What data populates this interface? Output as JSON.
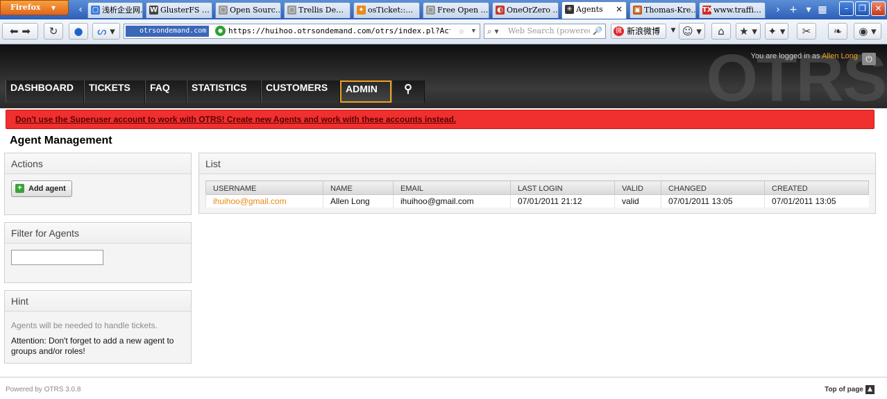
{
  "browser": {
    "menu_label": "Firefox",
    "tabs": [
      {
        "title": "浅析企业网…",
        "favicon": "page-icon",
        "color": "#3b7bd8"
      },
      {
        "title": "GlusterFS …",
        "favicon": "wikipedia-icon",
        "color": "#444444"
      },
      {
        "title": "Open Sourc…",
        "favicon": "page-icon",
        "color": "#999999"
      },
      {
        "title": "Trellis De…",
        "favicon": "page-icon",
        "color": "#999999"
      },
      {
        "title": "osTicket::…",
        "favicon": "osticket-icon",
        "color": "#e88b1a"
      },
      {
        "title": "Free Open …",
        "favicon": "page-icon",
        "color": "#999999"
      },
      {
        "title": "OneOrZero …",
        "favicon": "oneorzero-icon",
        "color": "#c33b2f"
      },
      {
        "title": "Agents",
        "favicon": "otrs-icon",
        "color": "#333333",
        "active": true
      },
      {
        "title": "Thomas-Kre…",
        "favicon": "thomas-icon",
        "color": "#c05a1a"
      },
      {
        "title": "www.traffi…",
        "favicon": "tx-icon",
        "color": "#d22b2b"
      }
    ],
    "address": {
      "identity": "otrsondemand.com",
      "url": "https://huihoo.otrsondemand.com/otrs/index.pl?Action=A"
    },
    "search_placeholder": "Web Search (powered",
    "weibo_label": "新浪微博"
  },
  "header": {
    "logo_text": "OTRS",
    "logged_in_prefix": "You are logged in as",
    "user_name": "Allen Long"
  },
  "nav": {
    "items": [
      "DASHBOARD",
      "TICKETS",
      "FAQ",
      "STATISTICS",
      "CUSTOMERS",
      "ADMIN"
    ],
    "active": "ADMIN"
  },
  "notice": "Don't use the Superuser account to work with OTRS! Create new Agents and work with these accounts instead.",
  "page_title": "Agent Management",
  "sidebar": {
    "actions_title": "Actions",
    "add_agent_label": "Add agent",
    "filter_title": "Filter for Agents",
    "filter_value": "",
    "hint_title": "Hint",
    "hint_text": "Agents will be needed to handle tickets.",
    "hint_attention": "Attention: Don't forget to add a new agent to groups and/or roles!"
  },
  "list": {
    "title": "List",
    "columns": [
      "USERNAME",
      "NAME",
      "EMAIL",
      "LAST LOGIN",
      "VALID",
      "CHANGED",
      "CREATED"
    ],
    "rows": [
      [
        "ihuihoo@gmail.com",
        "Allen Long",
        "ihuihoo@gmail.com",
        "07/01/2011 21:12",
        "valid",
        "07/01/2011 13:05",
        "07/01/2011 13:05"
      ]
    ]
  },
  "footer": {
    "powered": "Powered by OTRS 3.0.8",
    "top_link": "Top of page"
  },
  "colors": {
    "accent": "#f0a020",
    "notice_bg": "#f02f2f",
    "link": "#e8890f"
  }
}
